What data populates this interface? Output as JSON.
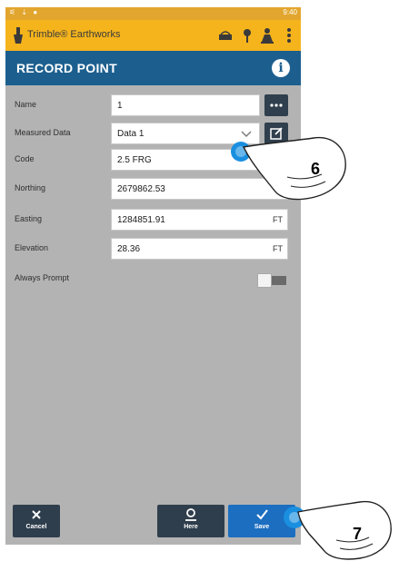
{
  "status_bar": {
    "time": "9:40"
  },
  "app_bar": {
    "app_name": "Trimble® Earthworks",
    "icons": [
      "trimble-logo-icon",
      "gnss-receiver-icon",
      "pin-icon",
      "person-icon",
      "more-vertical-icon"
    ]
  },
  "title_bar": {
    "title": "RECORD POINT",
    "info_icon": "info-icon",
    "info_glyph": "i"
  },
  "form": {
    "name": {
      "label": "Name",
      "value": "1"
    },
    "measured": {
      "label": "Measured Data",
      "value": "Data 1"
    },
    "code": {
      "label": "Code",
      "value": "2.5 FRG"
    },
    "northing": {
      "label": "Northing",
      "value": "2679862.53"
    },
    "easting": {
      "label": "Easting",
      "value": "1284851.91",
      "unit": "FT"
    },
    "elevation": {
      "label": "Elevation",
      "value": "28.36",
      "unit": "FT"
    },
    "always_prompt": {
      "label": "Always Prompt",
      "state": "off"
    }
  },
  "buttons": {
    "cancel": "Cancel",
    "here": "Here",
    "save": "Save"
  },
  "callouts": {
    "code_step": "6",
    "save_step": "7"
  },
  "colors": {
    "status": "#e2a62e",
    "appbar": "#f5b41c",
    "titlebar": "#1c5f8f",
    "form_bg": "#b3b3b3",
    "dark_button": "#2f3e4c",
    "save_button": "#1c6ec0",
    "tap_indicator": "#1a8fe0"
  }
}
